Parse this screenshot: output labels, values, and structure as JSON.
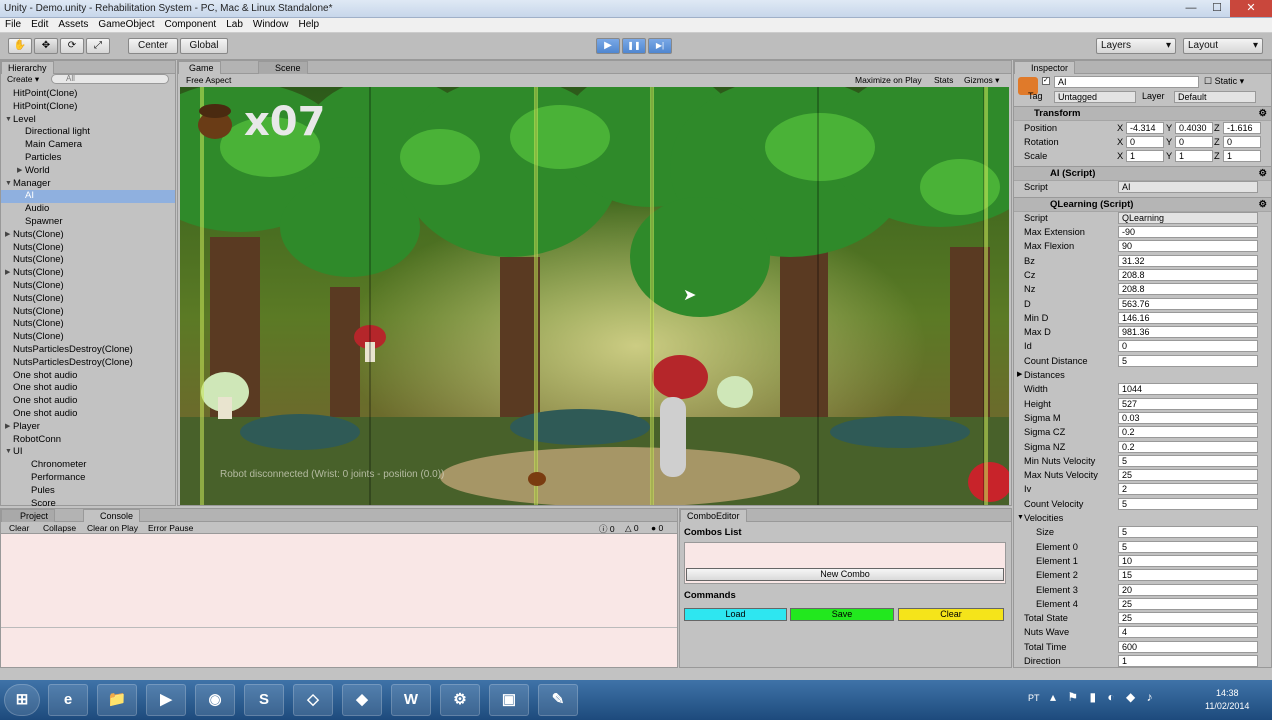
{
  "window": {
    "title": "Unity - Demo.unity - Rehabilitation System - PC, Mac & Linux Standalone*",
    "min": "—",
    "max": "☐",
    "close": "✕"
  },
  "menu": [
    "File",
    "Edit",
    "Assets",
    "GameObject",
    "Component",
    "Lab",
    "Window",
    "Help"
  ],
  "toolbar": {
    "center": "Center",
    "global": "Global",
    "layers": "Layers",
    "layout": "Layout",
    "hand": "✋",
    "move": "✥",
    "rotate": "⟳",
    "scale": "⤢",
    "play": "▶",
    "pause": "❚❚",
    "step": "▶|"
  },
  "hierarchy": {
    "tab": "Hierarchy",
    "create": "Create ▾",
    "search": "All",
    "items": [
      {
        "label": "HitPoint(Clone)",
        "indent": 0
      },
      {
        "label": "HitPoint(Clone)",
        "indent": 0
      },
      {
        "label": "Level",
        "indent": 0,
        "expanded": true
      },
      {
        "label": "Directional light",
        "indent": 2
      },
      {
        "label": "Main Camera",
        "indent": 2
      },
      {
        "label": "Particles",
        "indent": 2
      },
      {
        "label": "World",
        "indent": 2,
        "collapsed": true
      },
      {
        "label": "Manager",
        "indent": 0,
        "expanded": true
      },
      {
        "label": "AI",
        "indent": 2,
        "selected": true
      },
      {
        "label": "Audio",
        "indent": 2
      },
      {
        "label": "Spawner",
        "indent": 2
      },
      {
        "label": "Nuts(Clone)",
        "indent": 0,
        "collapsed": true
      },
      {
        "label": "Nuts(Clone)",
        "indent": 0
      },
      {
        "label": "Nuts(Clone)",
        "indent": 0
      },
      {
        "label": "Nuts(Clone)",
        "indent": 0,
        "collapsed": true
      },
      {
        "label": "Nuts(Clone)",
        "indent": 0
      },
      {
        "label": "Nuts(Clone)",
        "indent": 0
      },
      {
        "label": "Nuts(Clone)",
        "indent": 0
      },
      {
        "label": "Nuts(Clone)",
        "indent": 0
      },
      {
        "label": "Nuts(Clone)",
        "indent": 0
      },
      {
        "label": "NutsParticlesDestroy(Clone)",
        "indent": 0
      },
      {
        "label": "NutsParticlesDestroy(Clone)",
        "indent": 0
      },
      {
        "label": "One shot audio",
        "indent": 0
      },
      {
        "label": "One shot audio",
        "indent": 0
      },
      {
        "label": "One shot audio",
        "indent": 0
      },
      {
        "label": "One shot audio",
        "indent": 0
      },
      {
        "label": "Player",
        "indent": 0,
        "collapsed": true
      },
      {
        "label": "RobotConn",
        "indent": 0
      },
      {
        "label": "UI",
        "indent": 0,
        "expanded": true
      },
      {
        "label": "Chronometer",
        "indent": 3
      },
      {
        "label": "Performance",
        "indent": 3
      },
      {
        "label": "Pules",
        "indent": 3
      },
      {
        "label": "Score",
        "indent": 3
      }
    ]
  },
  "game": {
    "tab_game": "Game",
    "tab_scene": "Scene",
    "aspect": "Free Aspect",
    "maximize": "Maximize on Play",
    "stats": "Stats",
    "gizmos": "Gizmos ▾",
    "score": "x07",
    "status": "Robot disconnected (Wrist: 0 joints - position (0.0))"
  },
  "bottom": {
    "tab_project": "Project",
    "tab_console": "Console",
    "clear": "Clear",
    "collapse": "Collapse",
    "clear_on_play": "Clear on Play",
    "error_pause": "Error Pause",
    "counts": [
      "0",
      "0",
      "0"
    ]
  },
  "combo": {
    "tab": "ComboEditor",
    "list_label": "Combos List",
    "new_combo": "New Combo",
    "commands_label": "Commands",
    "load": "Load",
    "save": "Save",
    "clear": "Clear",
    "colors": {
      "load": "#2ee6f0",
      "save": "#22e81e",
      "clear": "#f5e41a"
    }
  },
  "inspector": {
    "tab": "Inspector",
    "name": "AI",
    "static": "Static ▾",
    "tag_label": "Tag",
    "tag": "Untagged",
    "layer_label": "Layer",
    "layer": "Default",
    "transform": {
      "title": "Transform",
      "position_label": "Position",
      "rotation_label": "Rotation",
      "scale_label": "Scale",
      "position": [
        "-4.314",
        "0.4030",
        "-1.616"
      ],
      "rotation": [
        "0",
        "0",
        "0"
      ],
      "scale": [
        "1",
        "1",
        "1"
      ]
    },
    "ai_script": {
      "title": "AI (Script)",
      "script_label": "Script",
      "script": "AI"
    },
    "qlearning": {
      "title": "QLearning (Script)",
      "script_label": "Script",
      "script": "QLearning"
    },
    "props": [
      {
        "label": "Max Extension",
        "value": "-90"
      },
      {
        "label": "Max Flexion",
        "value": "90"
      },
      {
        "label": "Bz",
        "value": "31.32"
      },
      {
        "label": "Cz",
        "value": "208.8"
      },
      {
        "label": "Nz",
        "value": "208.8"
      },
      {
        "label": "D",
        "value": "563.76"
      },
      {
        "label": "Min D",
        "value": "146.16"
      },
      {
        "label": "Max D",
        "value": "981.36"
      },
      {
        "label": "Id",
        "value": "0"
      },
      {
        "label": "Count Distance",
        "value": "5"
      },
      {
        "label": "Distances",
        "value": "",
        "fold": true
      },
      {
        "label": "Width",
        "value": "1044"
      },
      {
        "label": "Height",
        "value": "527"
      },
      {
        "label": "Sigma M",
        "value": "0.03"
      },
      {
        "label": "Sigma CZ",
        "value": "0.2"
      },
      {
        "label": "Sigma NZ",
        "value": "0.2"
      },
      {
        "label": "Min Nuts Velocity",
        "value": "5"
      },
      {
        "label": "Max Nuts Velocity",
        "value": "25"
      },
      {
        "label": "Iv",
        "value": "2"
      },
      {
        "label": "Count Velocity",
        "value": "5"
      },
      {
        "label": "Velocities",
        "value": "",
        "fold": true,
        "open": true
      },
      {
        "label": "Size",
        "value": "5",
        "sub": true
      },
      {
        "label": "Element 0",
        "value": "5",
        "sub": true
      },
      {
        "label": "Element 1",
        "value": "10",
        "sub": true
      },
      {
        "label": "Element 2",
        "value": "15",
        "sub": true
      },
      {
        "label": "Element 3",
        "value": "20",
        "sub": true
      },
      {
        "label": "Element 4",
        "value": "25",
        "sub": true
      },
      {
        "label": "Total State",
        "value": "25"
      },
      {
        "label": "Nuts Wave",
        "value": "4"
      },
      {
        "label": "Total Time",
        "value": "600"
      },
      {
        "label": "Direction",
        "value": "1"
      }
    ]
  },
  "taskbar": {
    "lang": "PT",
    "time": "14:38",
    "date": "11/02/2014",
    "apps": [
      "⊞",
      "e",
      "📁",
      "▶",
      "◉",
      "S",
      "◇",
      "◆",
      "W",
      "⚙",
      "▣",
      "✎"
    ]
  }
}
